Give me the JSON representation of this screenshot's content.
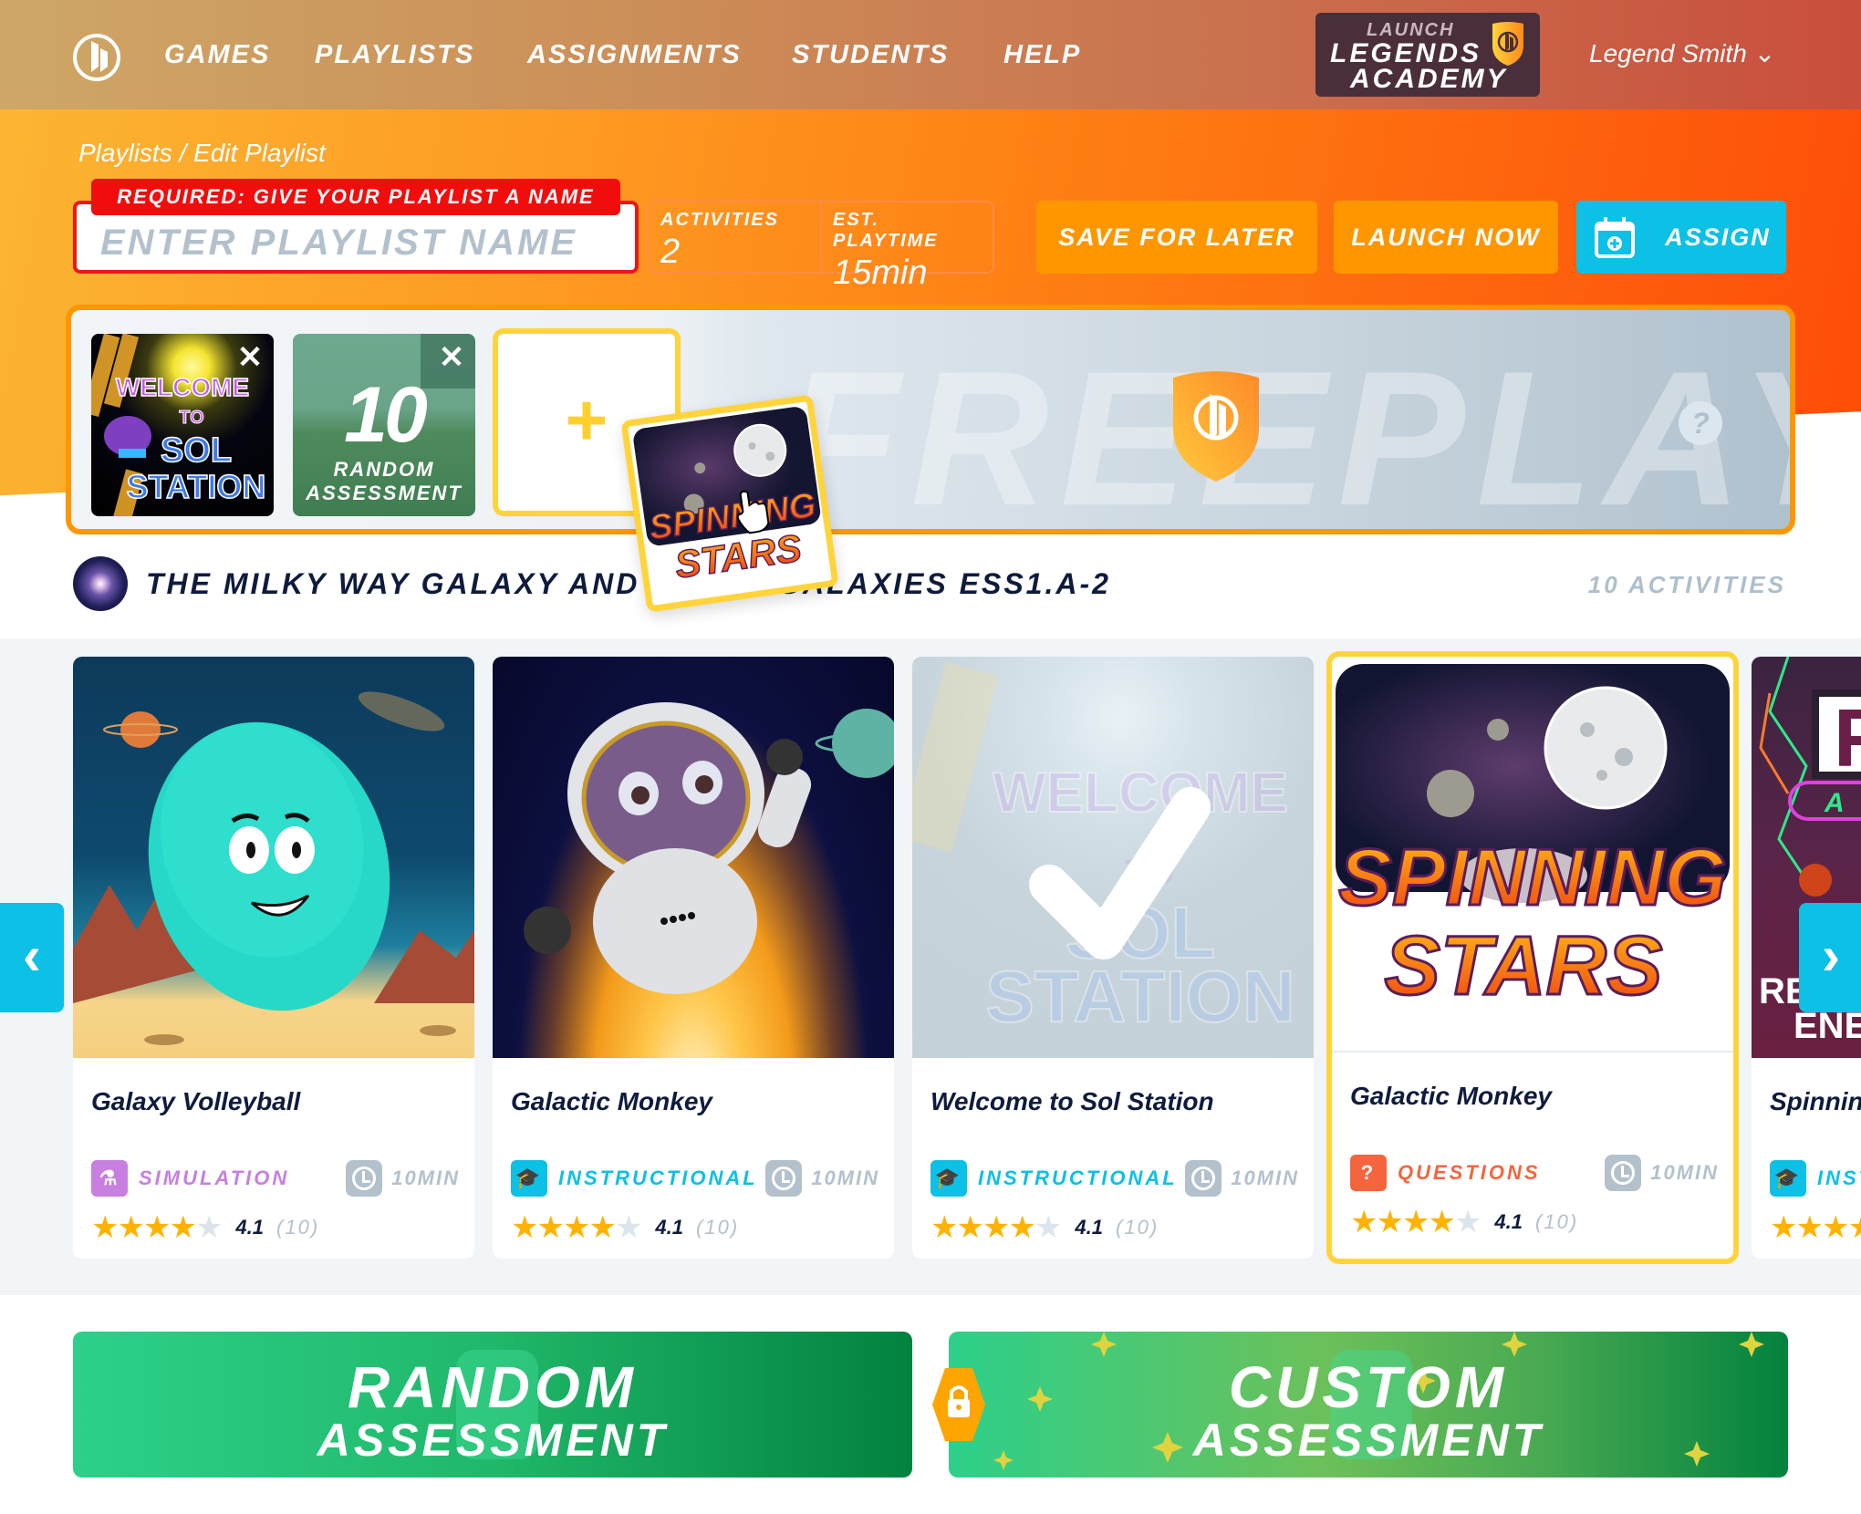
{
  "nav": {
    "links": [
      "GAMES",
      "PLAYLISTS",
      "ASSIGNMENTS",
      "STUDENTS",
      "HELP"
    ],
    "brand": {
      "line1": "LAUNCH",
      "line2": "LEGENDS",
      "line3": "ACADEMY"
    },
    "user": "Legend Smith",
    "user_chevron": "⌄"
  },
  "header": {
    "breadcrumb": "Playlists / Edit Playlist",
    "required_banner": "REQUIRED: GIVE YOUR PLAYLIST A NAME",
    "name_input": {
      "value": "",
      "placeholder": "ENTER PLAYLIST NAME"
    },
    "stats": {
      "activities_label": "ACTIVITIES",
      "activities_value": "2",
      "playtime_label": "EST. PLAYTIME",
      "playtime_value": "15min"
    },
    "buttons": {
      "save": "SAVE FOR LATER",
      "launch": "LAUNCH NOW",
      "assign": "ASSIGN"
    }
  },
  "tray": {
    "watermark": "FREEPLAY",
    "help": "?",
    "add": "+",
    "close": "✕",
    "items": [
      {
        "title_lines": [
          "WELCOME",
          "TO",
          "SOL",
          "STATION"
        ]
      },
      {
        "big": "10",
        "line1": "RANDOM",
        "line2": "ASSESSMENT"
      }
    ]
  },
  "drag_ghost": {
    "line1": "SPINNING",
    "line2": "STARS"
  },
  "section": {
    "title": "THE MILKY WAY GALAXY AND OTHER GALAXIES ESS1.A-2",
    "count": "10 ACTIVITIES"
  },
  "carousel": {
    "prev": "‹",
    "next": "›",
    "cards": [
      {
        "title": "Galaxy Volleyball",
        "type": "SIMULATION",
        "type_color": "#c77fe0",
        "duration": "10MIN",
        "rating": 4.1,
        "rating_text": "4.1",
        "count": "(10)",
        "selected": false,
        "added": false
      },
      {
        "title": "Galactic Monkey",
        "type": "INSTRUCTIONAL",
        "type_color": "#0cc0e6",
        "duration": "10MIN",
        "rating": 4.1,
        "rating_text": "4.1",
        "count": "(10)",
        "selected": false,
        "added": false
      },
      {
        "title": "Welcome to Sol Station",
        "type": "INSTRUCTIONAL",
        "type_color": "#0cc0e6",
        "duration": "10MIN",
        "rating": 4.1,
        "rating_text": "4.1",
        "count": "(10)",
        "selected": false,
        "added": true
      },
      {
        "title": "Galactic Monkey",
        "type": "QUESTIONS",
        "type_color": "#f5643d",
        "duration": "10MIN",
        "rating": 4.1,
        "rating_text": "4.1",
        "count": "(10)",
        "selected": true,
        "added": false,
        "art_lines": [
          "SPINNING",
          "STARS"
        ]
      },
      {
        "title": "Spinning",
        "type": "INST",
        "type_color": "#0cc0e6",
        "duration": "",
        "rating": 4.1,
        "rating_text": "",
        "count": "",
        "selected": false,
        "added": false,
        "art_lines": [
          "RE",
          "ENER"
        ]
      }
    ]
  },
  "assessments": {
    "random": {
      "line1": "RANDOM",
      "line2": "ASSESSMENT"
    },
    "custom": {
      "line1": "CUSTOM",
      "line2": "ASSESSMENT",
      "locked": true
    }
  },
  "colors": {
    "accent_orange": "#fe9600",
    "accent_blue": "#0cc0e6",
    "required_red": "#f20d0d",
    "highlight_yellow": "#ffd43b",
    "green": "#1fbf75",
    "navy": "#0e1b3d"
  }
}
